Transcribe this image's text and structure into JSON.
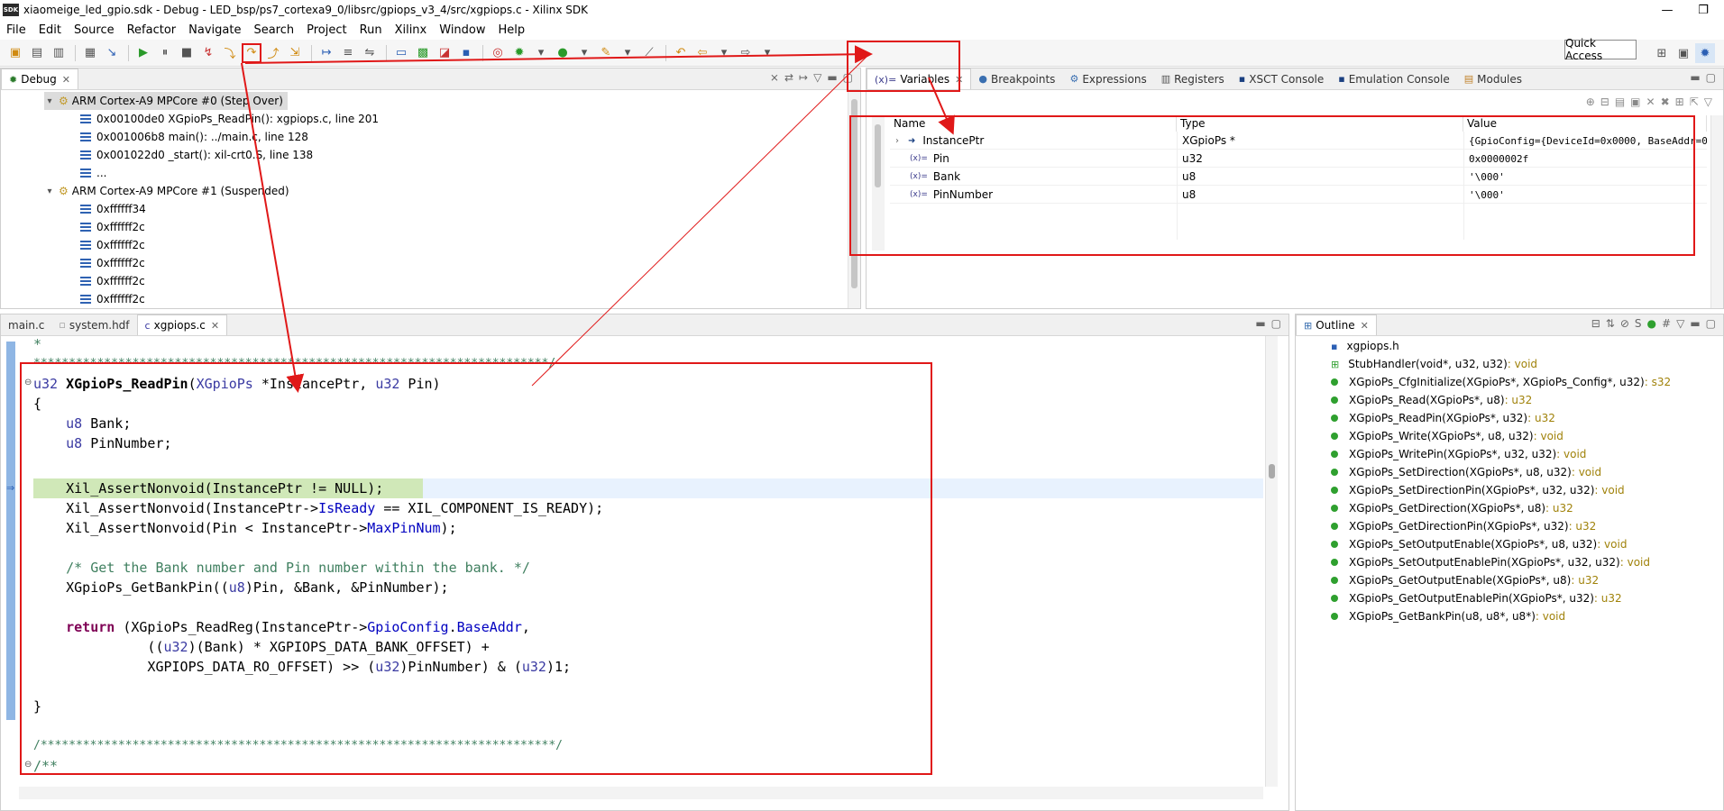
{
  "window": {
    "title": "xiaomeige_led_gpio.sdk - Debug - LED_bsp/ps7_cortexa9_0/libsrc/gpiops_v3_4/src/xgpiops.c - Xilinx SDK",
    "logo": "SDK",
    "minimize_icon": "minimize-icon",
    "restore_icon": "restore-icon"
  },
  "menu": [
    "File",
    "Edit",
    "Source",
    "Refactor",
    "Navigate",
    "Search",
    "Project",
    "Run",
    "Xilinx",
    "Window",
    "Help"
  ],
  "toolbar": {
    "quick_access": "Quick Access"
  },
  "debug": {
    "tab_label": "Debug",
    "threads": [
      {
        "label": "ARM Cortex-A9 MPCore #0 (Step Over)",
        "frames": [
          "0x00100de0 XGpioPs_ReadPin(): xgpiops.c, line 201",
          "0x001006b8 main(): ../main.c, line 128",
          "0x001022d0 _start(): xil-crt0.S, line 138",
          "..."
        ]
      },
      {
        "label": "ARM Cortex-A9 MPCore #1 (Suspended)",
        "frames": [
          "0xffffff34",
          "0xffffff2c",
          "0xffffff2c",
          "0xffffff2c",
          "0xffffff2c",
          "0xffffff2c"
        ]
      }
    ]
  },
  "right_tabs": [
    "Variables",
    "Breakpoints",
    "Expressions",
    "Registers",
    "XSCT Console",
    "Emulation Console",
    "Modules"
  ],
  "variables": {
    "columns": [
      "Name",
      "Type",
      "Value"
    ],
    "rows": [
      {
        "name": "InstancePtr",
        "type": "XGpioPs *",
        "value": "{GpioConfig={DeviceId=0x0000, BaseAddr=0x..."
      },
      {
        "name": "Pin",
        "type": "u32",
        "value": "0x0000002f"
      },
      {
        "name": "Bank",
        "type": "u8",
        "value": "'\\000'"
      },
      {
        "name": "PinNumber",
        "type": "u8",
        "value": "'\\000'"
      }
    ]
  },
  "editor": {
    "tabs": [
      "main.c",
      "system.hdf",
      "xgpiops.c"
    ],
    "active_tab": 2
  },
  "outline": {
    "tab_label": "Outline",
    "items": [
      {
        "name": "xgpiops.h",
        "ret": ""
      },
      {
        "name": "StubHandler(void*, u32, u32)",
        "ret": " : void"
      },
      {
        "name": "XGpioPs_CfgInitialize(XGpioPs*, XGpioPs_Config*, u32)",
        "ret": " : s32"
      },
      {
        "name": "XGpioPs_Read(XGpioPs*, u8)",
        "ret": " : u32"
      },
      {
        "name": "XGpioPs_ReadPin(XGpioPs*, u32)",
        "ret": " : u32"
      },
      {
        "name": "XGpioPs_Write(XGpioPs*, u8, u32)",
        "ret": " : void"
      },
      {
        "name": "XGpioPs_WritePin(XGpioPs*, u32, u32)",
        "ret": " : void"
      },
      {
        "name": "XGpioPs_SetDirection(XGpioPs*, u8, u32)",
        "ret": " : void"
      },
      {
        "name": "XGpioPs_SetDirectionPin(XGpioPs*, u32, u32)",
        "ret": " : void"
      },
      {
        "name": "XGpioPs_GetDirection(XGpioPs*, u8)",
        "ret": " : u32"
      },
      {
        "name": "XGpioPs_GetDirectionPin(XGpioPs*, u32)",
        "ret": " : u32"
      },
      {
        "name": "XGpioPs_SetOutputEnable(XGpioPs*, u8, u32)",
        "ret": " : void"
      },
      {
        "name": "XGpioPs_SetOutputEnablePin(XGpioPs*, u32, u32)",
        "ret": " : void"
      },
      {
        "name": "XGpioPs_GetOutputEnable(XGpioPs*, u8)",
        "ret": " : u32"
      },
      {
        "name": "XGpioPs_GetOutputEnablePin(XGpioPs*, u32)",
        "ret": " : u32"
      },
      {
        "name": "XGpioPs_GetBankPin(u8, u8*, u8*)",
        "ret": " : void"
      }
    ]
  },
  "colors": {
    "annotation_red": "#e01818",
    "current_line": "#e8f2fe",
    "exec_line": "#d0e8b8"
  }
}
